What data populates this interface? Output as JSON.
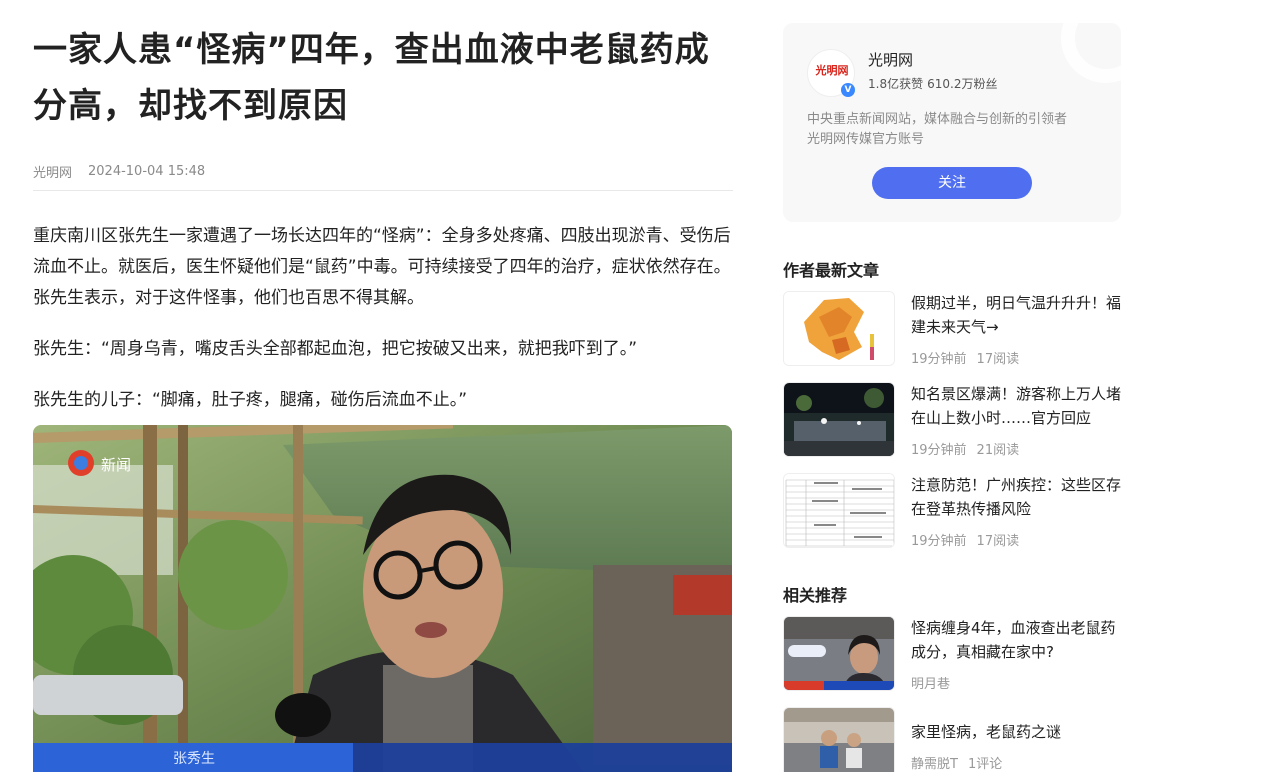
{
  "article": {
    "title": "一家人患“怪病”四年，查出血液中老鼠药成分高，却找不到原因",
    "source": "光明网",
    "datetime": "2024-10-04 15:48",
    "paragraphs": [
      "重庆南川区张先生一家遭遇了一场长达四年的“怪病”：全身多处疼痛、四肢出现淤青、受伤后流血不止。就医后，医生怀疑他们是“鼠药”中毒。可持续接受了四年的治疗，症状依然存在。张先生表示，对于这件怪事，他们也百思不得其解。",
      "张先生：“周身乌青，嘴皮舌头全部都起血泡，把它按破又出来，就把我吓到了。”",
      "张先生的儿子：“脚痛，肚子疼，腿痛，碰伤后流血不止。”"
    ],
    "photo": {
      "logo_text": "新闻",
      "caption_partial": "张秀生"
    }
  },
  "author": {
    "avatar_text": "光明网",
    "name": "光明网",
    "likes": "1.8亿获赞",
    "fans": "610.2万粉丝",
    "desc_line1": "中央重点新闻网站，媒体融合与创新的引领者",
    "desc_line2": "光明网传媒官方账号",
    "follow_label": "关注"
  },
  "latest": {
    "title": "作者最新文章",
    "items": [
      {
        "title": "假期过半，明日气温升升升！福建未来天气→",
        "time": "19分钟前",
        "reads": "17阅读"
      },
      {
        "title": "知名景区爆满！游客称上万人堵在山上数小时……官方回应",
        "time": "19分钟前",
        "reads": "21阅读"
      },
      {
        "title": "注意防范！广州疾控：这些区存在登革热传播风险",
        "time": "19分钟前",
        "reads": "17阅读"
      }
    ]
  },
  "related": {
    "title": "相关推荐",
    "items": [
      {
        "title": "怪病缠身4年，血液查出老鼠药成分，真相藏在家中?",
        "author": "明月巷",
        "stat": ""
      },
      {
        "title": "家里怪病，老鼠药之谜",
        "author": "静需脱T",
        "stat": "1评论"
      }
    ]
  },
  "colors": {
    "accent": "#4f6ff0",
    "muted": "#999999",
    "card_bg": "#f8f8f8"
  }
}
